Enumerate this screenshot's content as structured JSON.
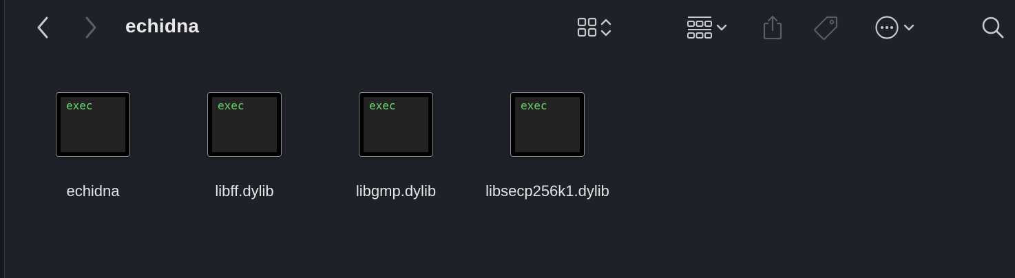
{
  "window": {
    "title": "echidna"
  },
  "toolbar": {
    "back": {
      "icon": "chevron-left-icon",
      "enabled": true
    },
    "forward": {
      "icon": "chevron-right-icon",
      "enabled": false
    },
    "view_mode": {
      "icon": "grid-view-icon"
    },
    "group_by": {
      "icon": "group-by-icon"
    },
    "share": {
      "icon": "share-icon",
      "enabled": false
    },
    "tags": {
      "icon": "tag-icon",
      "enabled": false
    },
    "more_actions": {
      "icon": "ellipsis-circle-icon"
    },
    "search": {
      "icon": "search-icon"
    }
  },
  "files": [
    {
      "name": "echidna",
      "icon_label": "exec"
    },
    {
      "name": "libff.dylib",
      "icon_label": "exec"
    },
    {
      "name": "libgmp.dylib",
      "icon_label": "exec"
    },
    {
      "name": "libsecp256k1.dylib",
      "icon_label": "exec"
    }
  ],
  "colors": {
    "background": "#1f2128",
    "exec_text": "#64d86a",
    "icon_enabled": "#c9c9cc",
    "icon_disabled": "#5b5d63"
  }
}
